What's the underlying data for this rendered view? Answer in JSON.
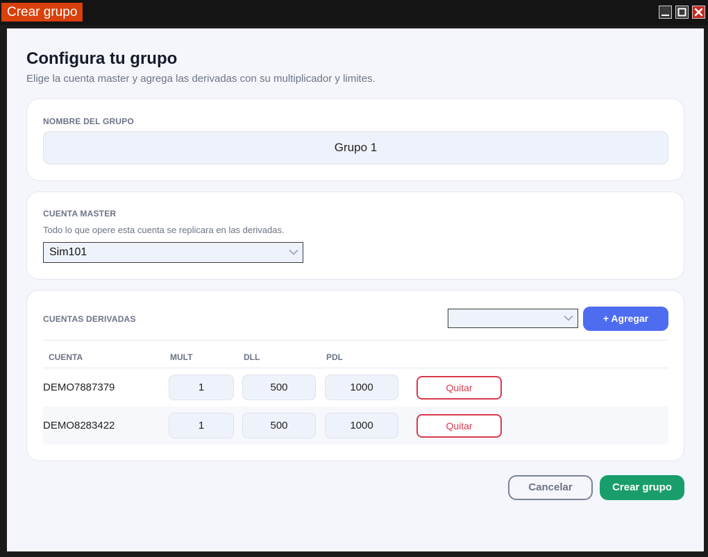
{
  "window": {
    "title": "Crear grupo",
    "controls": {
      "minimize": "minimize-icon",
      "maximize": "maximize-icon",
      "close": "close-icon"
    }
  },
  "page": {
    "title": "Configura tu grupo",
    "subtitle": "Elige la cuenta master y agrega las derivadas con su multiplicador y limites."
  },
  "group_name": {
    "label": "NOMBRE DEL GRUPO",
    "value": "Grupo 1"
  },
  "master": {
    "label": "CUENTA MASTER",
    "description": "Todo lo que opere esta cuenta se replicara en las derivadas.",
    "selected": "Sim101"
  },
  "derived": {
    "label": "CUENTAS DERIVADAS",
    "select_value": "",
    "add_label": "+ Agregar",
    "columns": [
      "CUENTA",
      "MULT",
      "DLL",
      "PDL"
    ],
    "rows": [
      {
        "account": "DEMO7887379",
        "mult": "1",
        "dll": "500",
        "pdl": "1000",
        "remove": "Quitar"
      },
      {
        "account": "DEMO8283422",
        "mult": "1",
        "dll": "500",
        "pdl": "1000",
        "remove": "Quitar"
      }
    ]
  },
  "footer": {
    "cancel": "Cancelar",
    "create": "Crear grupo"
  },
  "colors": {
    "title_tab": "#d9400a",
    "primary": "#4e6cf0",
    "success": "#199e6b",
    "danger": "#d8394d"
  }
}
